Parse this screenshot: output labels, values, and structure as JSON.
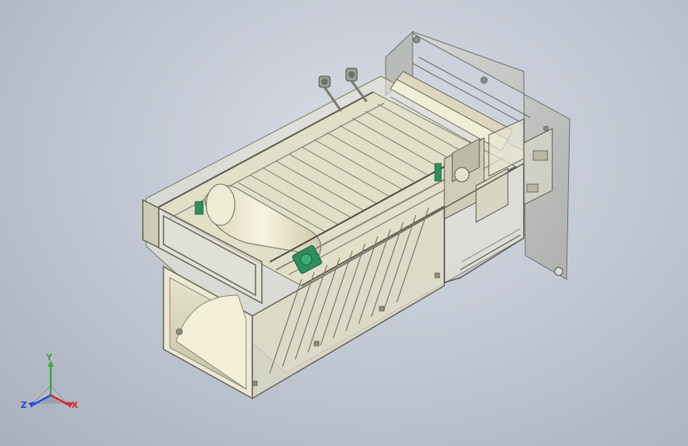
{
  "viewport": {
    "background_top": "#d9dde6",
    "background_bottom": "#a9b0bd",
    "model_colors": {
      "frame_light": "#ecebdc",
      "frame_mid": "#cfcdb8",
      "frame_dark": "#8f8d7c",
      "plate": "#c9cbc9",
      "motor_green": "#2e8f5e",
      "roller": "#f3f0dc"
    }
  },
  "triad": {
    "x_label": "X",
    "y_label": "Y",
    "z_label": "Z",
    "x_color": "#d22a2a",
    "y_color": "#3aa83a",
    "z_color": "#2a4ad2"
  }
}
